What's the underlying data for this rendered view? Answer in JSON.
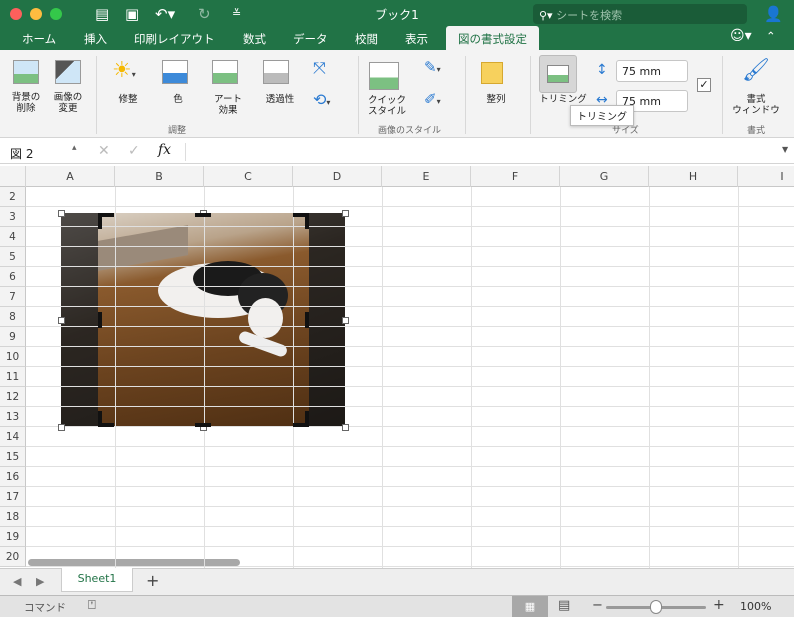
{
  "titlebar": {
    "title": "ブック1",
    "search_placeholder": "シートを検索"
  },
  "tabs": [
    "ホーム",
    "挿入",
    "印刷レイアウト",
    "数式",
    "データ",
    "校閲",
    "表示",
    "図の書式設定"
  ],
  "ribbon": {
    "remove_bg": "背景の\n削除",
    "change_pic": "画像の\n変更",
    "corrections": "修整",
    "color": "色",
    "artistic": "アート\n効果",
    "transparency": "透過性",
    "group_adjust": "調整",
    "quick_styles": "クイック\nスタイル",
    "group_styles": "画像のスタイル",
    "arrange": "整列",
    "crop": "トリミング",
    "height": "75 mm",
    "width": "75 mm",
    "group_size": "サイズ",
    "tooltip": "トリミング",
    "format_pane": "書式\nウィンドウ",
    "group_format": "書式"
  },
  "formula": {
    "name_box": "図 2",
    "fx": "fx",
    "value": ""
  },
  "columns": [
    "A",
    "B",
    "C",
    "D",
    "E",
    "F",
    "G",
    "H",
    "I"
  ],
  "rows": [
    "2",
    "3",
    "4",
    "5",
    "6",
    "7",
    "8",
    "9",
    "10",
    "11",
    "12",
    "13",
    "14",
    "15",
    "16",
    "17",
    "18",
    "19",
    "20"
  ],
  "sheet": {
    "tab": "Sheet1",
    "add": "+"
  },
  "status": {
    "mode": "コマンド",
    "zoom": "100%"
  },
  "colors": {
    "accent": "#217346"
  }
}
